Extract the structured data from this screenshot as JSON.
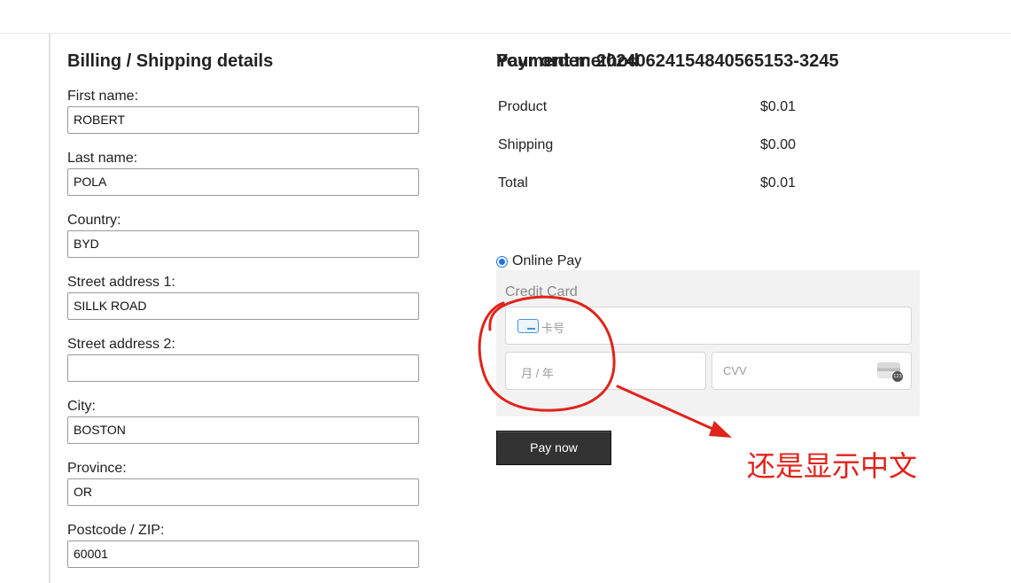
{
  "billing": {
    "title": "Billing / Shipping details",
    "fields": [
      {
        "label": "First name:",
        "value": "ROBERT"
      },
      {
        "label": "Last name:",
        "value": "POLA"
      },
      {
        "label": "Country:",
        "value": "BYD"
      },
      {
        "label": "Street address 1:",
        "value": "SILLK ROAD"
      },
      {
        "label": "Street address 2:",
        "value": ""
      },
      {
        "label": "City:",
        "value": "BOSTON"
      },
      {
        "label": "Province:",
        "value": "OR"
      },
      {
        "label": "Postcode / ZIP:",
        "value": "60001"
      }
    ]
  },
  "order": {
    "title": "Your order:  20240624154840565153-3245",
    "rows": [
      {
        "name": "Product",
        "amount": "$0.01"
      },
      {
        "name": "Shipping",
        "amount": "$0.00"
      },
      {
        "name": "Total",
        "amount": "$0.01"
      }
    ]
  },
  "payment": {
    "title": "Payment method",
    "option_label": "Online Pay",
    "option_selected": true,
    "card_panel_title": "Credit Card",
    "card_number_placeholder": "卡号",
    "expiry_placeholder": "月 / 年",
    "cvv_placeholder": "CVV",
    "cvv_badge": "123",
    "pay_button": "Pay now"
  },
  "annotation": {
    "text": "还是显示中文",
    "color": "#e0231b"
  }
}
